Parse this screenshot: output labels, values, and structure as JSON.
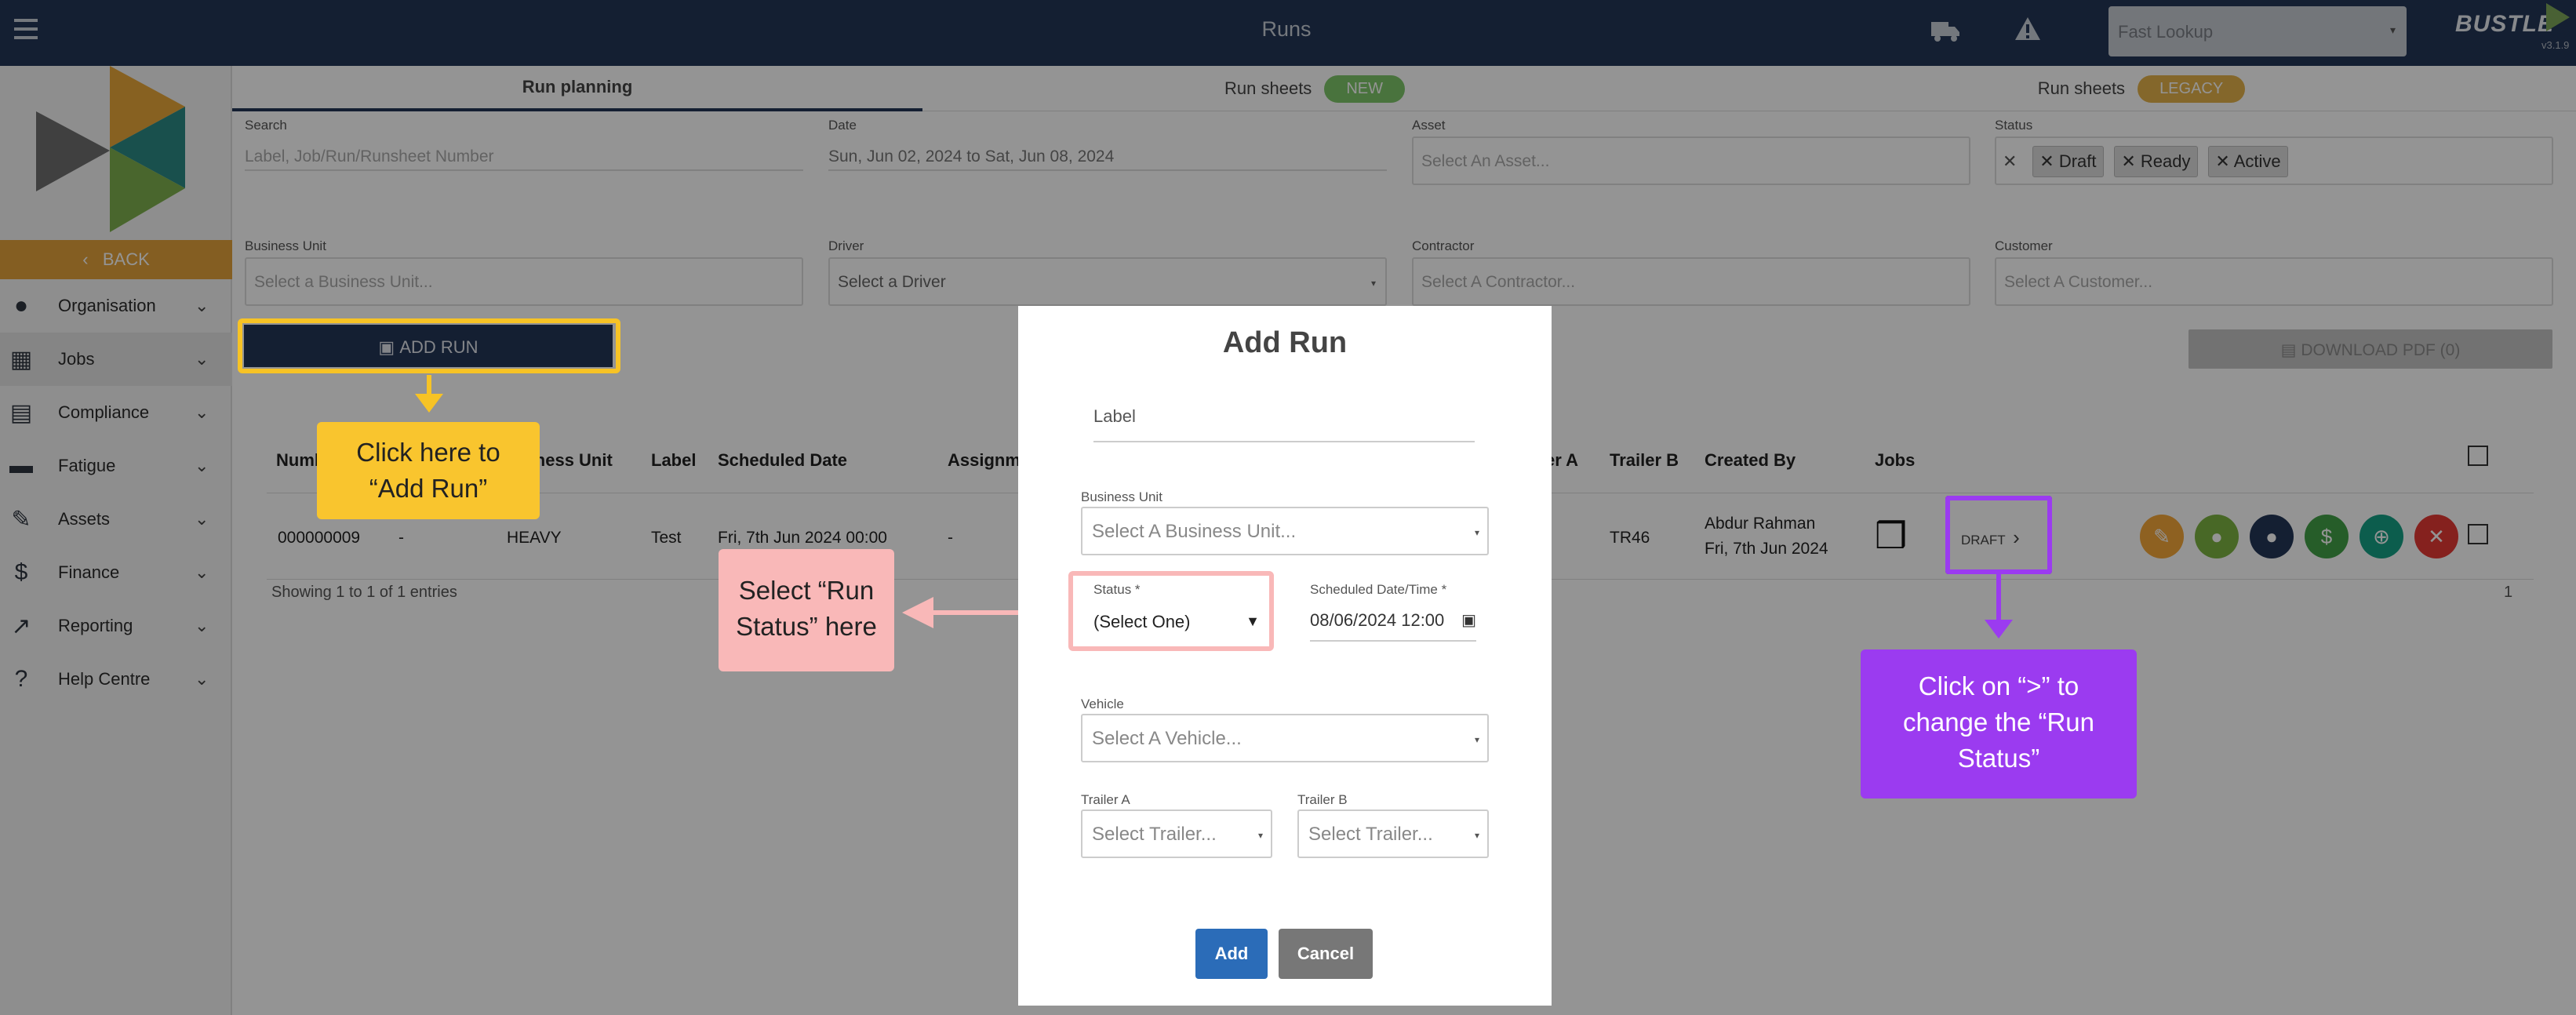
{
  "topbar": {
    "title": "Runs",
    "fast_lookup_placeholder": "Fast Lookup",
    "brand": "BUSTLE",
    "version": "v3.1.9"
  },
  "sidebar": {
    "back_label": "BACK",
    "items": [
      {
        "label": "Organisation",
        "icon": "person-icon"
      },
      {
        "label": "Jobs",
        "icon": "boxes-icon"
      },
      {
        "label": "Compliance",
        "icon": "id-card-icon"
      },
      {
        "label": "Fatigue",
        "icon": "bed-icon"
      },
      {
        "label": "Assets",
        "icon": "wrench-icon"
      },
      {
        "label": "Finance",
        "icon": "dollar-icon"
      },
      {
        "label": "Reporting",
        "icon": "chart-icon"
      },
      {
        "label": "Help Centre",
        "icon": "question-icon"
      }
    ]
  },
  "tabs": [
    {
      "label": "Run planning"
    },
    {
      "label": "Run sheets",
      "badge": "NEW"
    },
    {
      "label": "Run sheets",
      "badge": "LEGACY"
    }
  ],
  "filters": {
    "search": {
      "label": "Search",
      "placeholder": "Label, Job/Run/Runsheet Number"
    },
    "date": {
      "label": "Date",
      "value": "Sun, Jun 02, 2024 to Sat, Jun 08, 2024"
    },
    "asset": {
      "label": "Asset",
      "placeholder": "Select An Asset..."
    },
    "status": {
      "label": "Status",
      "chips": [
        "Draft",
        "Ready",
        "Active"
      ]
    },
    "business_unit": {
      "label": "Business Unit",
      "placeholder": "Select a Business Unit..."
    },
    "driver": {
      "label": "Driver",
      "placeholder": "Select a Driver"
    },
    "contractor": {
      "label": "Contractor",
      "placeholder": "Select A Contractor..."
    },
    "customer": {
      "label": "Customer",
      "placeholder": "Select A Customer..."
    }
  },
  "actions": {
    "add_run": "ADD RUN",
    "download_pdf": "DOWNLOAD PDF (0)"
  },
  "table": {
    "headers": [
      "Numb",
      "usiness Unit",
      "Label",
      "Scheduled Date",
      "Assignm",
      "er A",
      "Trailer B",
      "Created By",
      "Jobs"
    ],
    "row": {
      "number": "000000009",
      "dash1": "-",
      "business_unit": "HEAVY",
      "label": "Test",
      "scheduled_date": "Fri, 7th Jun 2024 00:00",
      "assignment": "-",
      "trailer_b": "TR46",
      "created_by_name": "Abdur Rahman",
      "created_by_date": "Fri, 7th Jun 2024",
      "status": "DRAFT"
    },
    "footer": "Showing 1 to 1 of 1 entries",
    "page": "1"
  },
  "modal": {
    "title": "Add Run",
    "label_field": "Label",
    "business_unit_label": "Business Unit",
    "business_unit_placeholder": "Select A Business Unit...",
    "status_label": "Status *",
    "status_value": "(Select One)",
    "scheduled_label": "Scheduled Date/Time *",
    "scheduled_value": "08/06/2024 12:00",
    "vehicle_label": "Vehicle",
    "vehicle_placeholder": "Select A Vehicle...",
    "trailer_a_label": "Trailer A",
    "trailer_a_placeholder": "Select Trailer...",
    "trailer_b_label": "Trailer B",
    "trailer_b_placeholder": "Select Trailer...",
    "add_label": "Add",
    "cancel_label": "Cancel"
  },
  "callouts": {
    "add_run_line1": "Click here to",
    "add_run_line2": "“Add Run”",
    "status_line1": "Select “Run",
    "status_line2": "Status” here",
    "change_line1": "Click on “>” to",
    "change_line2": "change the “Run",
    "change_line3": "Status”"
  },
  "colors": {
    "navy": "#243656",
    "orange": "#e3a33c",
    "yellow_callout": "#f9c52e",
    "pink_callout": "#f9b8b8",
    "purple_callout": "#9b3bf0",
    "add_blue": "#2b6cb8"
  }
}
